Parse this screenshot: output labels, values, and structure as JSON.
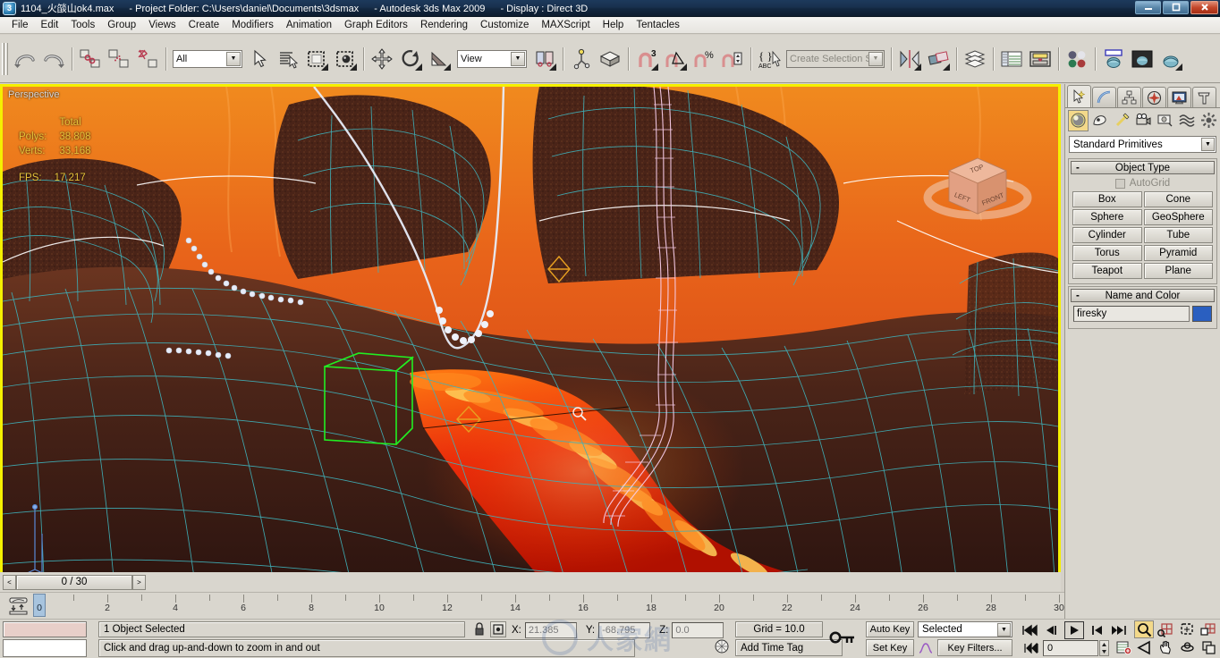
{
  "window": {
    "icon": "max-app-icon",
    "filename": "1104_火燄山ok4.max",
    "project": "- Project Folder: C:\\Users\\daniel\\Documents\\3dsmax",
    "app": "- Autodesk 3ds Max  2009",
    "display": "- Display : Direct 3D",
    "minimize": "—",
    "maximize": "❐",
    "close": "✕"
  },
  "menu": {
    "items": [
      "File",
      "Edit",
      "Tools",
      "Group",
      "Views",
      "Create",
      "Modifiers",
      "Animation",
      "Graph Editors",
      "Rendering",
      "Customize",
      "MAXScript",
      "Help",
      "Tentacles"
    ]
  },
  "toolbar": {
    "selection_filter": "All",
    "reference_coord": "View",
    "selection_set_placeholder": "Create Selection Set",
    "buttons": [
      {
        "name": "undo-icon",
        "label": "Undo"
      },
      {
        "name": "redo-icon",
        "label": "Redo"
      },
      {
        "name": "select-and-link-icon",
        "label": "Select and Link"
      },
      {
        "name": "unlink-selection-icon",
        "label": "Unlink Selection"
      },
      {
        "name": "bind-to-space-warp-icon",
        "label": "Bind to Space Warp"
      },
      {
        "name": "select-object-icon",
        "label": "Select Object"
      },
      {
        "name": "select-by-name-icon",
        "label": "Select by Name"
      },
      {
        "name": "rectangular-selection-region-icon",
        "label": "Rectangular Selection Region"
      },
      {
        "name": "window-crossing-icon",
        "label": "Window / Crossing"
      },
      {
        "name": "select-and-move-icon",
        "label": "Select and Move"
      },
      {
        "name": "select-and-rotate-icon",
        "label": "Select and Rotate"
      },
      {
        "name": "select-and-scale-icon",
        "label": "Select and Uniform Scale"
      },
      {
        "name": "use-pivot-point-center-icon",
        "label": "Use Pivot Point Center"
      },
      {
        "name": "select-and-manipulate-icon",
        "label": "Select and Manipulate"
      },
      {
        "name": "keyboard-shortcut-override-icon",
        "label": "Keyboard Shortcut Override Toggle"
      },
      {
        "name": "snaps-toggle-icon",
        "label": "3D Snaps Toggle"
      },
      {
        "name": "angle-snap-toggle-icon",
        "label": "Angle Snap Toggle"
      },
      {
        "name": "percent-snap-toggle-icon",
        "label": "Percent Snap Toggle"
      },
      {
        "name": "spinner-snap-toggle-icon",
        "label": "Spinner Snap Toggle"
      },
      {
        "name": "named-selection-sets-icon",
        "label": "Named Selection Sets"
      },
      {
        "name": "mirror-icon",
        "label": "Mirror"
      },
      {
        "name": "align-icon",
        "label": "Align"
      },
      {
        "name": "layer-manager-icon",
        "label": "Layer Manager"
      },
      {
        "name": "curve-editor-icon",
        "label": "Curve Editor"
      },
      {
        "name": "schematic-view-icon",
        "label": "Schematic View"
      },
      {
        "name": "material-editor-icon",
        "label": "Material Editor"
      },
      {
        "name": "render-setup-icon",
        "label": "Render Setup"
      },
      {
        "name": "rendered-frame-window-icon",
        "label": "Rendered Frame Window"
      },
      {
        "name": "render-production-icon",
        "label": "Render Production"
      }
    ]
  },
  "viewport": {
    "label": "Perspective",
    "stats": {
      "header": "Total",
      "polys_label": "Polys:",
      "polys_value": "38,808",
      "verts_label": "Verts:",
      "verts_value": "33,168",
      "fps_label": "FPS:",
      "fps_value": "17.217"
    },
    "viewcube": {
      "top": "TOP",
      "left": "LEFT",
      "front": "FRONT"
    },
    "cursor": "zoom-cursor"
  },
  "command_panel": {
    "tabs": [
      {
        "name": "create-tab",
        "label": "Create",
        "selected": true
      },
      {
        "name": "modify-tab",
        "label": "Modify",
        "selected": false
      },
      {
        "name": "hierarchy-tab",
        "label": "Hierarchy",
        "selected": false
      },
      {
        "name": "motion-tab",
        "label": "Motion",
        "selected": false
      },
      {
        "name": "display-tab",
        "label": "Display",
        "selected": false
      },
      {
        "name": "utilities-tab",
        "label": "Utilities",
        "selected": false
      }
    ],
    "subtabs": [
      {
        "name": "geometry-subtab",
        "label": "Geometry",
        "selected": true
      },
      {
        "name": "shapes-subtab",
        "label": "Shapes",
        "selected": false
      },
      {
        "name": "lights-subtab",
        "label": "Lights",
        "selected": false
      },
      {
        "name": "cameras-subtab",
        "label": "Cameras",
        "selected": false
      },
      {
        "name": "helpers-subtab",
        "label": "Helpers",
        "selected": false
      },
      {
        "name": "space-warps-subtab",
        "label": "Space Warps",
        "selected": false
      },
      {
        "name": "systems-subtab",
        "label": "Systems",
        "selected": false
      }
    ],
    "category": "Standard Primitives",
    "object_type": {
      "title": "Object Type",
      "collapse": "-",
      "autogrid": "AutoGrid",
      "buttons": [
        "Box",
        "Cone",
        "Sphere",
        "GeoSphere",
        "Cylinder",
        "Tube",
        "Torus",
        "Pyramid",
        "Teapot",
        "Plane"
      ]
    },
    "name_and_color": {
      "title": "Name and Color",
      "collapse": "-",
      "name": "firesky",
      "color": "#2a5fc0"
    }
  },
  "time_slider": {
    "prev": "<",
    "next": ">",
    "current": "0 / 30"
  },
  "track_bar": {
    "start": 0,
    "end": 30,
    "labels": [
      "0",
      "2",
      "4",
      "6",
      "8",
      "10",
      "12",
      "14",
      "16",
      "18",
      "20",
      "22",
      "24",
      "26",
      "28",
      "30"
    ],
    "playhead": "0"
  },
  "status_bar": {
    "selection": "1 Object Selected",
    "prompt": "Click and drag up-and-down to zoom in and out",
    "lock_icon": "lock-selection-icon",
    "absolute_icon": "absolute-relative-transform-icon",
    "coords": {
      "x_label": "X:",
      "x_value": "21.385",
      "y_label": "Y:",
      "y_value": "-68.795",
      "z_label": "Z:",
      "z_value": "0.0"
    },
    "grid": "Grid = 10.0",
    "time_tag": "Add Time Tag",
    "key_mode_icon": "key-mode-toggle-icon",
    "animation": {
      "auto_key": "Auto Key",
      "set_key": "Set Key",
      "filter_selected": "Selected",
      "key_filters": "Key Filters...",
      "current_frame": "0"
    },
    "playback": [
      {
        "name": "go-to-start-button",
        "glyph": "|◀◀"
      },
      {
        "name": "previous-frame-button",
        "glyph": "◀|"
      },
      {
        "name": "play-animation-button",
        "glyph": "▶"
      },
      {
        "name": "next-frame-button",
        "glyph": "|▶"
      },
      {
        "name": "go-to-end-button",
        "glyph": "▶▶|"
      }
    ],
    "viewport_nav": [
      {
        "name": "zoom-button",
        "glyph": "search",
        "active": true
      },
      {
        "name": "zoom-all-button",
        "glyph": "zoom-all"
      },
      {
        "name": "zoom-extents-button",
        "glyph": "zoom-extents"
      },
      {
        "name": "zoom-region-button",
        "glyph": "zoom-region"
      },
      {
        "name": "field-of-view-button",
        "glyph": "fov"
      },
      {
        "name": "pan-view-button",
        "glyph": "hand"
      },
      {
        "name": "orbit-button",
        "glyph": "orbit"
      },
      {
        "name": "maximize-viewport-toggle-button",
        "glyph": "maximize"
      }
    ]
  },
  "colors": {
    "viewport_border": "#f5f000",
    "panel_bg": "#d9d6ce",
    "title_bg": "#16304d",
    "stats_text": "#e8c33a",
    "selected_object": "#00ff00",
    "helper_orange": "#e8a020",
    "particle_pink": "#f3c8e8"
  }
}
